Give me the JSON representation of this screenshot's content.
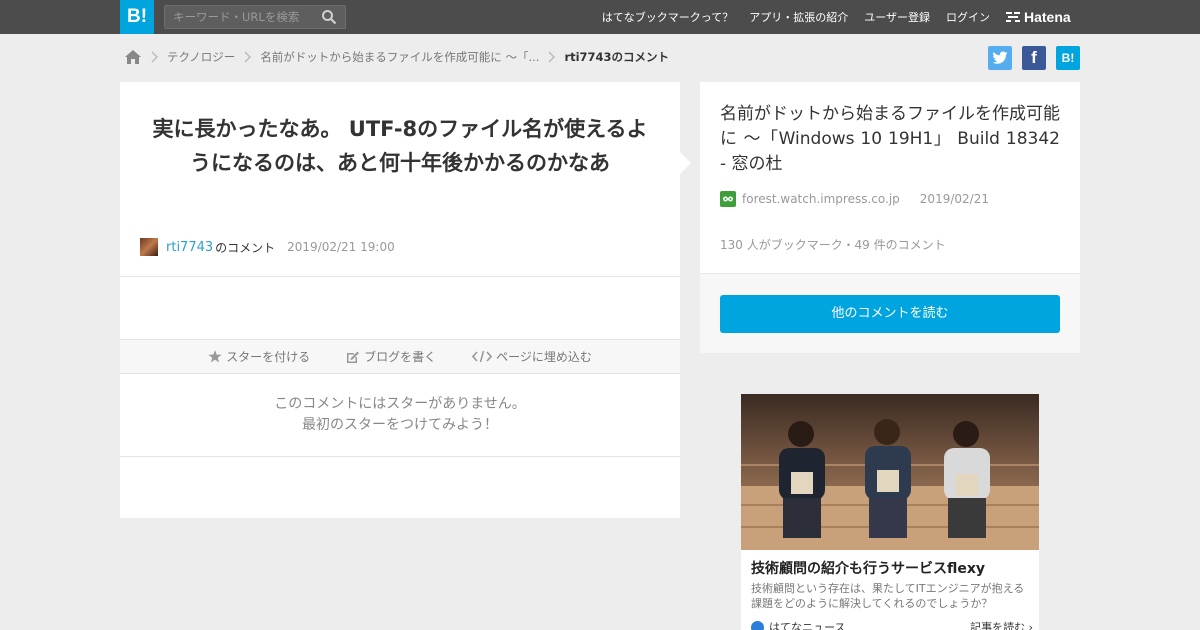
{
  "topbar": {
    "logo": "B!",
    "search_placeholder": "キーワード・URLを検索",
    "nav": [
      "はてなブックマークって？",
      "アプリ・拡張の紹介",
      "ユーザー登録",
      "ログイン"
    ],
    "brand": "Hatena"
  },
  "breadcrumb": {
    "category": "テクノロジー",
    "entry": "名前がドットから始まるファイルを作成可能に ～「...",
    "current": "rti7743のコメント"
  },
  "share": {
    "hatena_label": "B!"
  },
  "comment": {
    "text": "実に長かったなあ。 UTF-8のファイル名が使えるようになるのは、あと何十年後かかるのかなあ",
    "user": "rti7743",
    "suffix": "のコメント",
    "date": "2019/02/21 19:00"
  },
  "actions": {
    "star": "スターを付ける",
    "blog": "ブログを書く",
    "embed": "ページに埋め込む"
  },
  "stars": {
    "line1": "このコメントにはスターがありません。",
    "line2": "最初のスターをつけてみよう！"
  },
  "entry": {
    "title": "名前がドットから始まるファイルを作成可能に ～「Windows 10 19H1」 Build 18342 - 窓の杜",
    "domain": "forest.watch.impress.co.jp",
    "date": "2019/02/21",
    "stats": "130 人がブックマーク・49 件のコメント",
    "read_button": "他のコメントを読む"
  },
  "ad": {
    "title": "技術顧問の紹介も行うサービスflexy",
    "description": "技術顧問という存在は、果たしてITエンジニアが抱える課題をどのように解決してくれるのでしょうか？",
    "source": "はてなニュース",
    "more": "記事を読む ›"
  },
  "colors": {
    "accent": "#00a4de",
    "topbar": "#4c4c4c",
    "twitter": "#55acee",
    "facebook": "#3b5998"
  }
}
